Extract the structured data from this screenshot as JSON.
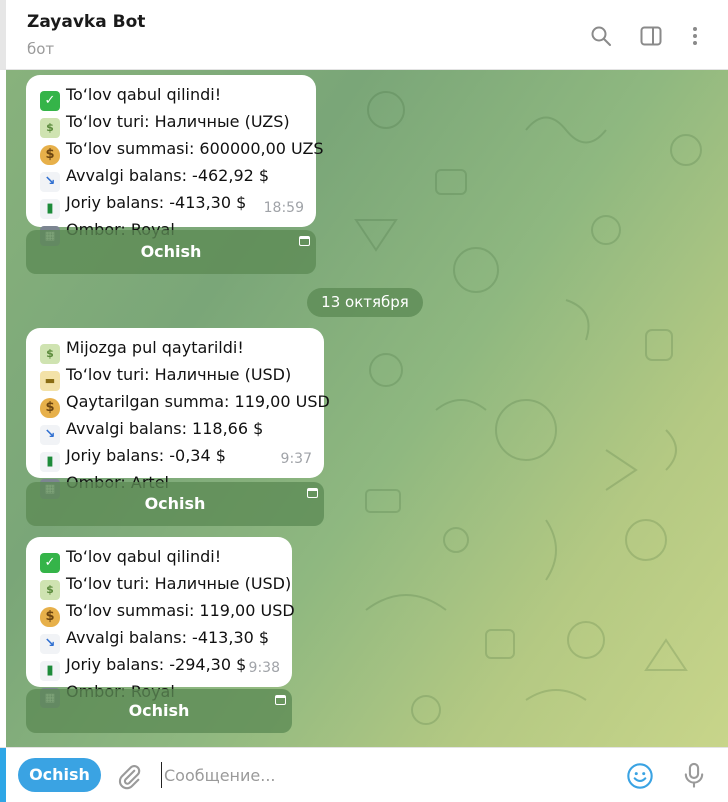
{
  "header": {
    "title": "Zayavka Bot",
    "subtitle": "бот",
    "icons": [
      "search-icon",
      "sidebar-toggle-icon",
      "more-vertical-icon"
    ]
  },
  "date_separator": "13 октября",
  "messages": [
    {
      "lines": [
        {
          "icon": "check-mark-icon",
          "text": "To‘lov qabul qilindi!"
        },
        {
          "icon": "money-wings-icon",
          "text": "To‘lov turi: Наличные (UZS)"
        },
        {
          "icon": "money-bag-icon",
          "text": "To‘lov summasi: 600000,00 UZS"
        },
        {
          "icon": "chart-down-icon",
          "text": "Avvalgi balans: -462,92 $"
        },
        {
          "icon": "bar-chart-icon",
          "text": "Joriy balans: -413,30 $"
        },
        {
          "icon": "office-building-icon",
          "text": "Ombor: Royal"
        }
      ],
      "time": "18:59",
      "button": "Ochish"
    },
    {
      "lines": [
        {
          "icon": "banknote-icon",
          "text": "Mijozga pul qaytarildi!"
        },
        {
          "icon": "credit-card-icon",
          "text": "To‘lov turi: Наличные (USD)"
        },
        {
          "icon": "money-bag-icon",
          "text": "Qaytarilgan summa: 119,00 USD"
        },
        {
          "icon": "chart-down-icon",
          "text": "Avvalgi balans: 118,66 $"
        },
        {
          "icon": "bar-chart-icon",
          "text": "Joriy balans: -0,34 $"
        },
        {
          "icon": "office-building-icon",
          "text": "Ombor: Artel"
        }
      ],
      "time": "9:37",
      "button": "Ochish"
    },
    {
      "lines": [
        {
          "icon": "check-mark-icon",
          "text": "To‘lov qabul qilindi!"
        },
        {
          "icon": "money-wings-icon",
          "text": "To‘lov turi: Наличные (USD)"
        },
        {
          "icon": "money-bag-icon",
          "text": "To‘lov summasi: 119,00 USD"
        },
        {
          "icon": "chart-down-icon",
          "text": "Avvalgi balans: -413,30 $"
        },
        {
          "icon": "bar-chart-icon",
          "text": "Joriy balans: -294,30 $"
        },
        {
          "icon": "office-building-icon",
          "text": "Ombor: Royal"
        }
      ],
      "time": "9:38",
      "button": "Ochish"
    }
  ],
  "composer": {
    "menu_button": "Ochish",
    "placeholder": "Сообщение...",
    "icons": [
      "attach-icon",
      "emoji-icon",
      "microphone-icon"
    ]
  },
  "colors": {
    "accent": "#3aa3e3",
    "inline_button": "#5c8a54",
    "check_green": "#35b449"
  }
}
